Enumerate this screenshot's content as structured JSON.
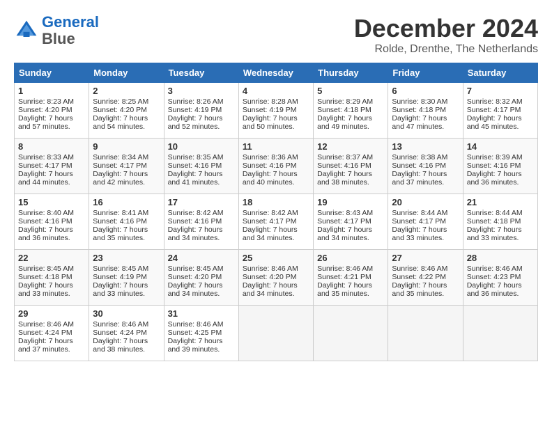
{
  "header": {
    "logo_line1": "General",
    "logo_line2": "Blue",
    "month": "December 2024",
    "location": "Rolde, Drenthe, The Netherlands"
  },
  "days_of_week": [
    "Sunday",
    "Monday",
    "Tuesday",
    "Wednesday",
    "Thursday",
    "Friday",
    "Saturday"
  ],
  "weeks": [
    [
      {
        "day": "1",
        "sunrise": "8:23 AM",
        "sunset": "4:20 PM",
        "daylight": "7 hours and 57 minutes."
      },
      {
        "day": "2",
        "sunrise": "8:25 AM",
        "sunset": "4:20 PM",
        "daylight": "7 hours and 54 minutes."
      },
      {
        "day": "3",
        "sunrise": "8:26 AM",
        "sunset": "4:19 PM",
        "daylight": "7 hours and 52 minutes."
      },
      {
        "day": "4",
        "sunrise": "8:28 AM",
        "sunset": "4:19 PM",
        "daylight": "7 hours and 50 minutes."
      },
      {
        "day": "5",
        "sunrise": "8:29 AM",
        "sunset": "4:18 PM",
        "daylight": "7 hours and 49 minutes."
      },
      {
        "day": "6",
        "sunrise": "8:30 AM",
        "sunset": "4:18 PM",
        "daylight": "7 hours and 47 minutes."
      },
      {
        "day": "7",
        "sunrise": "8:32 AM",
        "sunset": "4:17 PM",
        "daylight": "7 hours and 45 minutes."
      }
    ],
    [
      {
        "day": "8",
        "sunrise": "8:33 AM",
        "sunset": "4:17 PM",
        "daylight": "7 hours and 44 minutes."
      },
      {
        "day": "9",
        "sunrise": "8:34 AM",
        "sunset": "4:17 PM",
        "daylight": "7 hours and 42 minutes."
      },
      {
        "day": "10",
        "sunrise": "8:35 AM",
        "sunset": "4:16 PM",
        "daylight": "7 hours and 41 minutes."
      },
      {
        "day": "11",
        "sunrise": "8:36 AM",
        "sunset": "4:16 PM",
        "daylight": "7 hours and 40 minutes."
      },
      {
        "day": "12",
        "sunrise": "8:37 AM",
        "sunset": "4:16 PM",
        "daylight": "7 hours and 38 minutes."
      },
      {
        "day": "13",
        "sunrise": "8:38 AM",
        "sunset": "4:16 PM",
        "daylight": "7 hours and 37 minutes."
      },
      {
        "day": "14",
        "sunrise": "8:39 AM",
        "sunset": "4:16 PM",
        "daylight": "7 hours and 36 minutes."
      }
    ],
    [
      {
        "day": "15",
        "sunrise": "8:40 AM",
        "sunset": "4:16 PM",
        "daylight": "7 hours and 36 minutes."
      },
      {
        "day": "16",
        "sunrise": "8:41 AM",
        "sunset": "4:16 PM",
        "daylight": "7 hours and 35 minutes."
      },
      {
        "day": "17",
        "sunrise": "8:42 AM",
        "sunset": "4:16 PM",
        "daylight": "7 hours and 34 minutes."
      },
      {
        "day": "18",
        "sunrise": "8:42 AM",
        "sunset": "4:17 PM",
        "daylight": "7 hours and 34 minutes."
      },
      {
        "day": "19",
        "sunrise": "8:43 AM",
        "sunset": "4:17 PM",
        "daylight": "7 hours and 34 minutes."
      },
      {
        "day": "20",
        "sunrise": "8:44 AM",
        "sunset": "4:17 PM",
        "daylight": "7 hours and 33 minutes."
      },
      {
        "day": "21",
        "sunrise": "8:44 AM",
        "sunset": "4:18 PM",
        "daylight": "7 hours and 33 minutes."
      }
    ],
    [
      {
        "day": "22",
        "sunrise": "8:45 AM",
        "sunset": "4:18 PM",
        "daylight": "7 hours and 33 minutes."
      },
      {
        "day": "23",
        "sunrise": "8:45 AM",
        "sunset": "4:19 PM",
        "daylight": "7 hours and 33 minutes."
      },
      {
        "day": "24",
        "sunrise": "8:45 AM",
        "sunset": "4:20 PM",
        "daylight": "7 hours and 34 minutes."
      },
      {
        "day": "25",
        "sunrise": "8:46 AM",
        "sunset": "4:20 PM",
        "daylight": "7 hours and 34 minutes."
      },
      {
        "day": "26",
        "sunrise": "8:46 AM",
        "sunset": "4:21 PM",
        "daylight": "7 hours and 35 minutes."
      },
      {
        "day": "27",
        "sunrise": "8:46 AM",
        "sunset": "4:22 PM",
        "daylight": "7 hours and 35 minutes."
      },
      {
        "day": "28",
        "sunrise": "8:46 AM",
        "sunset": "4:23 PM",
        "daylight": "7 hours and 36 minutes."
      }
    ],
    [
      {
        "day": "29",
        "sunrise": "8:46 AM",
        "sunset": "4:24 PM",
        "daylight": "7 hours and 37 minutes."
      },
      {
        "day": "30",
        "sunrise": "8:46 AM",
        "sunset": "4:24 PM",
        "daylight": "7 hours and 38 minutes."
      },
      {
        "day": "31",
        "sunrise": "8:46 AM",
        "sunset": "4:25 PM",
        "daylight": "7 hours and 39 minutes."
      },
      null,
      null,
      null,
      null
    ]
  ]
}
